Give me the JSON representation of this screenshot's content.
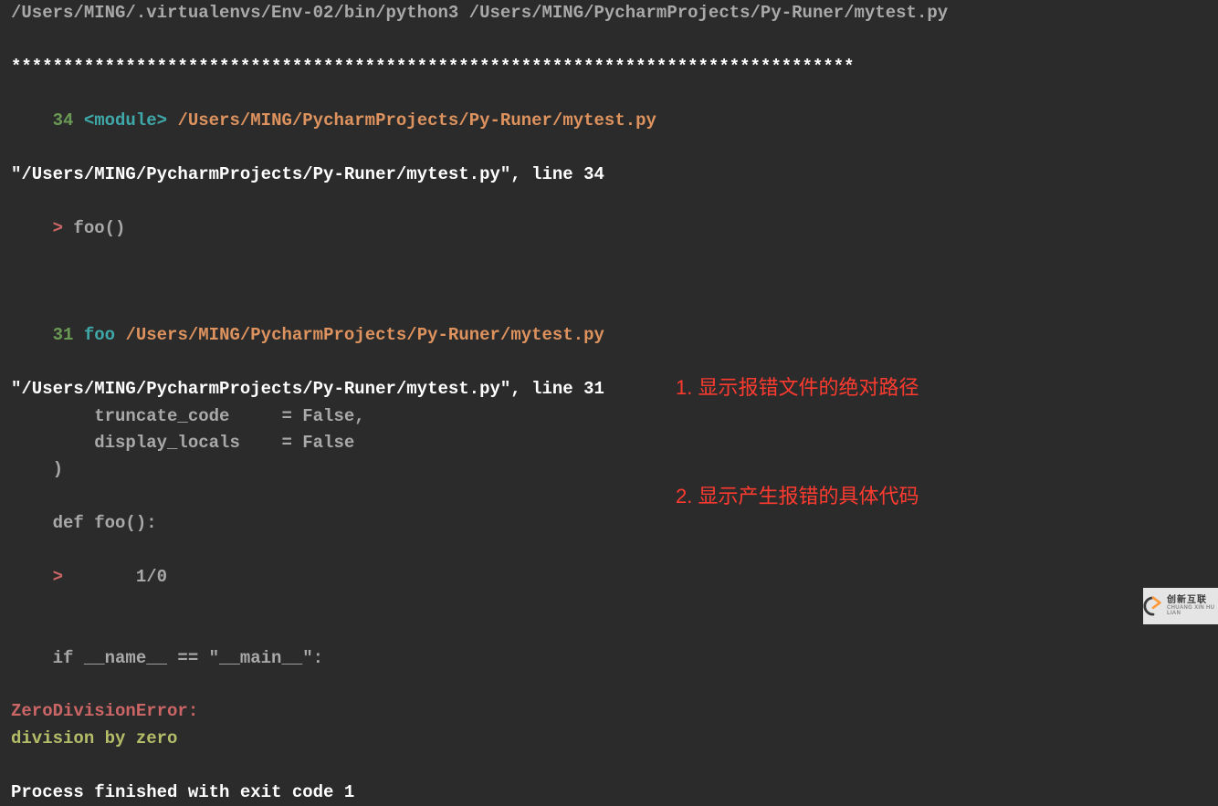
{
  "console": {
    "cmd_line": "/Users/MING/.virtualenvs/Env-02/bin/python3 /Users/MING/PycharmProjects/Py-Runer/mytest.py",
    "separator": "*********************************************************************************",
    "frame1": {
      "lineno": "34",
      "name": "<module>",
      "path": "/Users/MING/PycharmProjects/Py-Runer/mytest.py",
      "location": "\"/Users/MING/PycharmProjects/Py-Runer/mytest.py\", line 34",
      "marker": ">",
      "code": " foo()"
    },
    "frame2": {
      "lineno": "31",
      "name": "foo",
      "path": "/Users/MING/PycharmProjects/Py-Runer/mytest.py",
      "location": "\"/Users/MING/PycharmProjects/Py-Runer/mytest.py\", line 31",
      "code1": "        truncate_code     = False,",
      "code2": "        display_locals    = False",
      "code3": "    )",
      "code4": "    def foo():",
      "marker5": ">",
      "code5": "       1/0",
      "code6": "    if __name__ == \"__main__\":"
    },
    "error_type": "ZeroDivisionError:",
    "error_msg": "division by zero",
    "exit_line": "Process finished with exit code 1"
  },
  "annotations": {
    "line1": "1. 显示报错文件的绝对路径",
    "line2": "2. 显示产生报错的具体代码"
  },
  "watermark": {
    "cn": "创新互联",
    "en": "CHUANG XIN HU LIAN"
  }
}
